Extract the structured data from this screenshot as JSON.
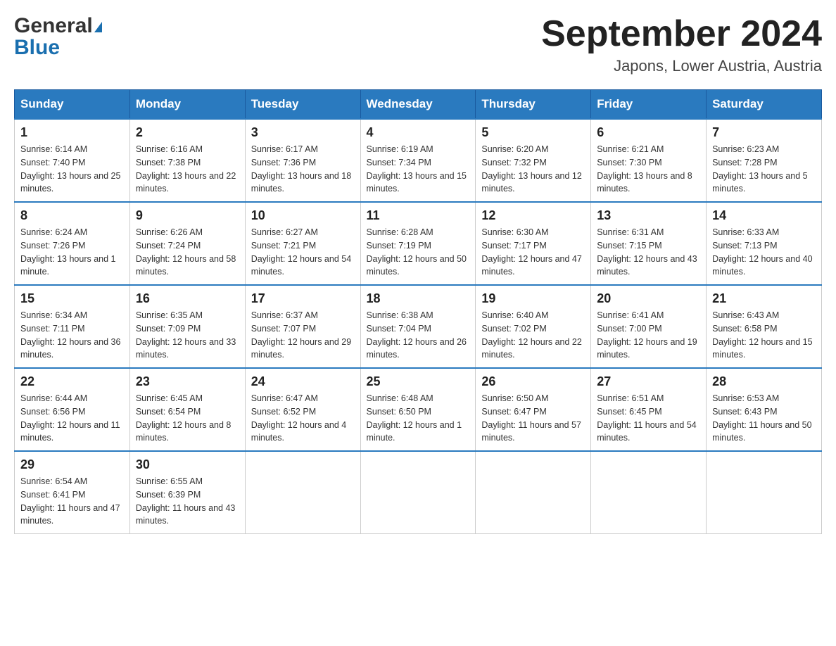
{
  "header": {
    "logo_general": "General",
    "logo_blue": "Blue",
    "month_title": "September 2024",
    "location": "Japons, Lower Austria, Austria"
  },
  "days_of_week": [
    "Sunday",
    "Monday",
    "Tuesday",
    "Wednesday",
    "Thursday",
    "Friday",
    "Saturday"
  ],
  "weeks": [
    [
      {
        "day": "1",
        "sunrise": "6:14 AM",
        "sunset": "7:40 PM",
        "daylight": "13 hours and 25 minutes."
      },
      {
        "day": "2",
        "sunrise": "6:16 AM",
        "sunset": "7:38 PM",
        "daylight": "13 hours and 22 minutes."
      },
      {
        "day": "3",
        "sunrise": "6:17 AM",
        "sunset": "7:36 PM",
        "daylight": "13 hours and 18 minutes."
      },
      {
        "day": "4",
        "sunrise": "6:19 AM",
        "sunset": "7:34 PM",
        "daylight": "13 hours and 15 minutes."
      },
      {
        "day": "5",
        "sunrise": "6:20 AM",
        "sunset": "7:32 PM",
        "daylight": "13 hours and 12 minutes."
      },
      {
        "day": "6",
        "sunrise": "6:21 AM",
        "sunset": "7:30 PM",
        "daylight": "13 hours and 8 minutes."
      },
      {
        "day": "7",
        "sunrise": "6:23 AM",
        "sunset": "7:28 PM",
        "daylight": "13 hours and 5 minutes."
      }
    ],
    [
      {
        "day": "8",
        "sunrise": "6:24 AM",
        "sunset": "7:26 PM",
        "daylight": "13 hours and 1 minute."
      },
      {
        "day": "9",
        "sunrise": "6:26 AM",
        "sunset": "7:24 PM",
        "daylight": "12 hours and 58 minutes."
      },
      {
        "day": "10",
        "sunrise": "6:27 AM",
        "sunset": "7:21 PM",
        "daylight": "12 hours and 54 minutes."
      },
      {
        "day": "11",
        "sunrise": "6:28 AM",
        "sunset": "7:19 PM",
        "daylight": "12 hours and 50 minutes."
      },
      {
        "day": "12",
        "sunrise": "6:30 AM",
        "sunset": "7:17 PM",
        "daylight": "12 hours and 47 minutes."
      },
      {
        "day": "13",
        "sunrise": "6:31 AM",
        "sunset": "7:15 PM",
        "daylight": "12 hours and 43 minutes."
      },
      {
        "day": "14",
        "sunrise": "6:33 AM",
        "sunset": "7:13 PM",
        "daylight": "12 hours and 40 minutes."
      }
    ],
    [
      {
        "day": "15",
        "sunrise": "6:34 AM",
        "sunset": "7:11 PM",
        "daylight": "12 hours and 36 minutes."
      },
      {
        "day": "16",
        "sunrise": "6:35 AM",
        "sunset": "7:09 PM",
        "daylight": "12 hours and 33 minutes."
      },
      {
        "day": "17",
        "sunrise": "6:37 AM",
        "sunset": "7:07 PM",
        "daylight": "12 hours and 29 minutes."
      },
      {
        "day": "18",
        "sunrise": "6:38 AM",
        "sunset": "7:04 PM",
        "daylight": "12 hours and 26 minutes."
      },
      {
        "day": "19",
        "sunrise": "6:40 AM",
        "sunset": "7:02 PM",
        "daylight": "12 hours and 22 minutes."
      },
      {
        "day": "20",
        "sunrise": "6:41 AM",
        "sunset": "7:00 PM",
        "daylight": "12 hours and 19 minutes."
      },
      {
        "day": "21",
        "sunrise": "6:43 AM",
        "sunset": "6:58 PM",
        "daylight": "12 hours and 15 minutes."
      }
    ],
    [
      {
        "day": "22",
        "sunrise": "6:44 AM",
        "sunset": "6:56 PM",
        "daylight": "12 hours and 11 minutes."
      },
      {
        "day": "23",
        "sunrise": "6:45 AM",
        "sunset": "6:54 PM",
        "daylight": "12 hours and 8 minutes."
      },
      {
        "day": "24",
        "sunrise": "6:47 AM",
        "sunset": "6:52 PM",
        "daylight": "12 hours and 4 minutes."
      },
      {
        "day": "25",
        "sunrise": "6:48 AM",
        "sunset": "6:50 PM",
        "daylight": "12 hours and 1 minute."
      },
      {
        "day": "26",
        "sunrise": "6:50 AM",
        "sunset": "6:47 PM",
        "daylight": "11 hours and 57 minutes."
      },
      {
        "day": "27",
        "sunrise": "6:51 AM",
        "sunset": "6:45 PM",
        "daylight": "11 hours and 54 minutes."
      },
      {
        "day": "28",
        "sunrise": "6:53 AM",
        "sunset": "6:43 PM",
        "daylight": "11 hours and 50 minutes."
      }
    ],
    [
      {
        "day": "29",
        "sunrise": "6:54 AM",
        "sunset": "6:41 PM",
        "daylight": "11 hours and 47 minutes."
      },
      {
        "day": "30",
        "sunrise": "6:55 AM",
        "sunset": "6:39 PM",
        "daylight": "11 hours and 43 minutes."
      },
      null,
      null,
      null,
      null,
      null
    ]
  ]
}
